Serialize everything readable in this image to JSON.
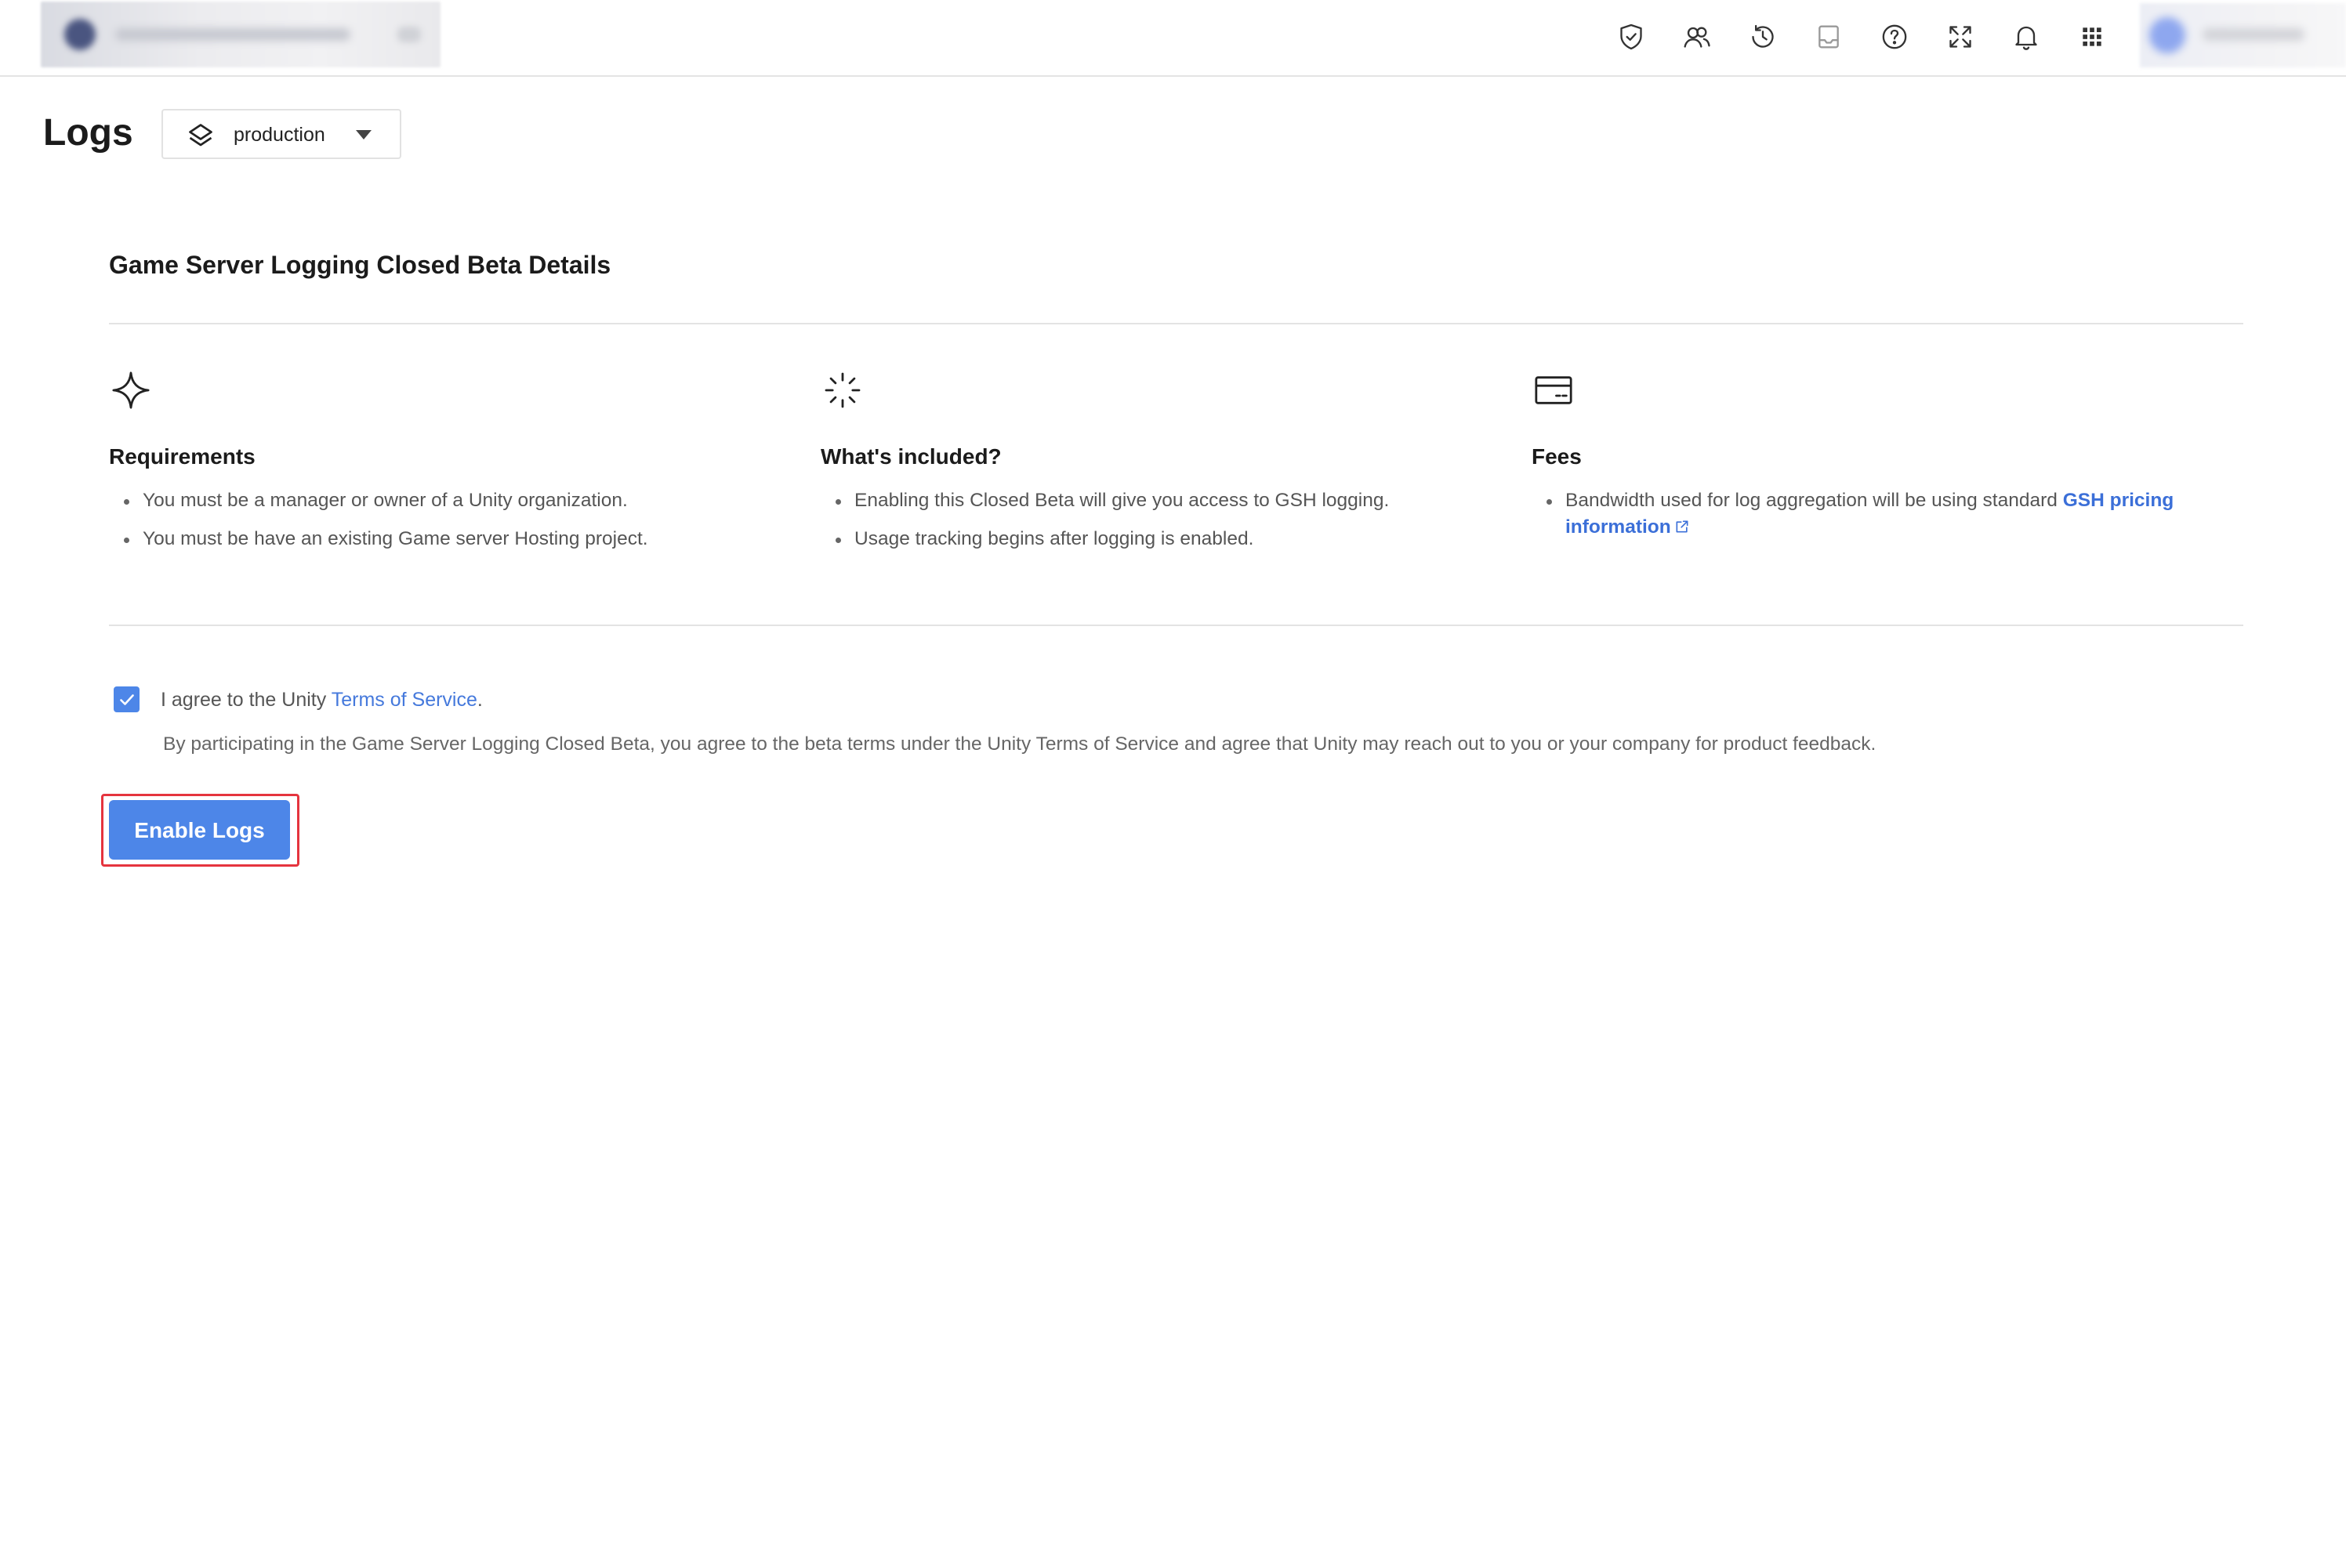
{
  "topbar": {
    "icons": [
      "shield-check-icon",
      "users-icon",
      "history-icon",
      "inbox-icon",
      "help-icon",
      "fullscreen-icon",
      "bell-icon",
      "apps-grid-icon"
    ]
  },
  "page": {
    "title": "Logs",
    "environment": "production"
  },
  "section": {
    "title": "Game Server Logging Closed Beta Details"
  },
  "columns": [
    {
      "icon": "sparkle-icon",
      "heading": "Requirements",
      "items": [
        "You must be a manager or owner of a Unity organization.",
        "You must be have an existing Game server Hosting project."
      ]
    },
    {
      "icon": "loader-icon",
      "heading": "What's included?",
      "items": [
        "Enabling this Closed Beta will give you access to GSH logging.",
        "Usage tracking begins after logging is enabled."
      ]
    },
    {
      "icon": "credit-card-icon",
      "heading": "Fees",
      "item_text": "Bandwidth used for log aggregation will be using standard ",
      "item_link": "GSH pricing information"
    }
  ],
  "agreement": {
    "checked": true,
    "prefix": "I agree to the Unity ",
    "link": "Terms of Service",
    "suffix": ".",
    "note": "By participating in the Game Server Logging Closed Beta, you agree to the beta terms under the Unity Terms of Service and agree that Unity may reach out to you or your company for product feedback."
  },
  "action": {
    "enable_label": "Enable Logs"
  },
  "colors": {
    "accent": "#4d86e8",
    "link": "#3b6fd8",
    "highlight": "#e5343e"
  }
}
